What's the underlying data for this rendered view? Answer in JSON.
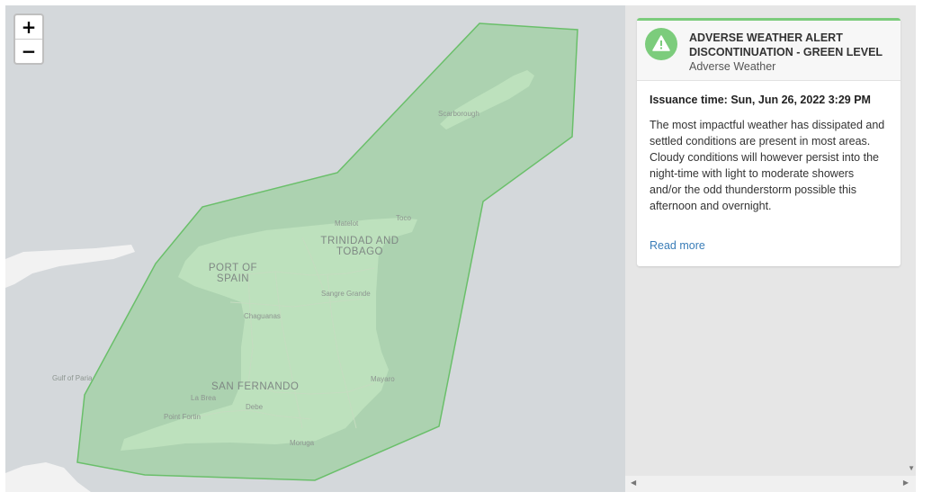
{
  "map": {
    "zoom_in": "+",
    "zoom_out": "−",
    "labels": {
      "scarborough": "Scarborough",
      "matelot": "Matelot",
      "toco": "Toco",
      "country_line1": "TRINIDAD AND",
      "country_line2": "TOBAGO",
      "port_line1": "PORT OF",
      "port_line2": "SPAIN",
      "sangre_grande": "Sangre Grande",
      "chaguanas": "Chaguanas",
      "gulf_of_paria": "Gulf of Paria",
      "san_fernando": "SAN FERNANDO",
      "mayaro": "Mayaro",
      "la_brea": "La Brea",
      "debe": "Debe",
      "point_fortin": "Point Fortin",
      "moruga": "Moruga"
    },
    "alert_area_color": "#7ccc7c",
    "water_color": "#d4d8db",
    "land_color": "#f2f2f2"
  },
  "alert": {
    "accent_color": "#7ccc7c",
    "icon": "warning-triangle-icon",
    "title": "ADVERSE WEATHER ALERT DISCONTINUATION - GREEN LEVEL",
    "subtitle": "Adverse Weather",
    "issuance_label": "Issuance time:",
    "issuance_value": "Sun, Jun 26, 2022 3:29 PM",
    "description": "The most impactful weather has dissipated and settled conditions are present in most areas. Cloudy conditions will however persist into the night-time with light to moderate showers and/or the odd thunderstorm possible this afternoon and overnight.",
    "read_more": "Read more"
  }
}
